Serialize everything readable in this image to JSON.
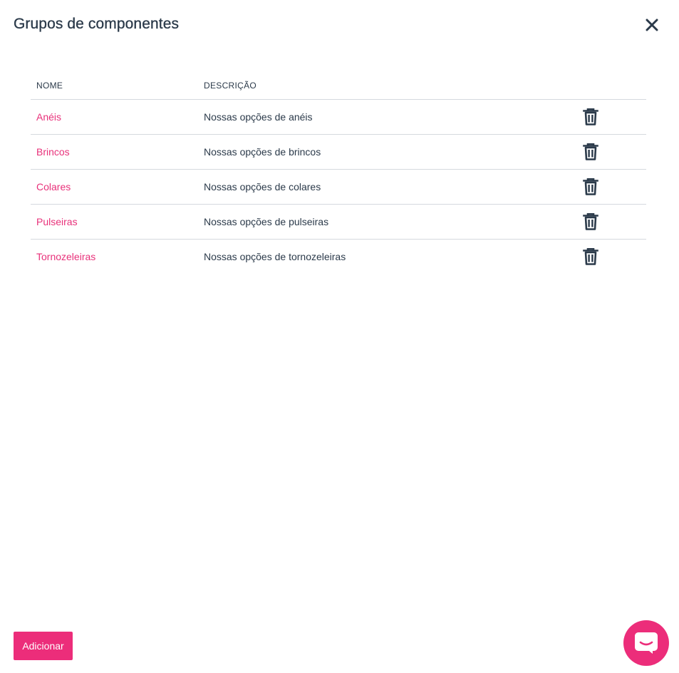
{
  "modal": {
    "title": "Grupos de componentes"
  },
  "table": {
    "headers": {
      "name": "NOME",
      "description": "DESCRIÇÃO"
    },
    "rows": [
      {
        "name": "Anéis",
        "description": "Nossas opções de anéis"
      },
      {
        "name": "Brincos",
        "description": "Nossas opções de brincos"
      },
      {
        "name": "Colares",
        "description": "Nossas opções de colares"
      },
      {
        "name": "Pulseiras",
        "description": "Nossas opções de pulseiras"
      },
      {
        "name": "Tornozeleiras",
        "description": "Nossas opções de tornozeleiras"
      }
    ]
  },
  "footer": {
    "add_label": "Adicionar"
  },
  "icons": {
    "close": "close-icon",
    "delete": "trash-icon",
    "chat": "chat-icon"
  },
  "colors": {
    "accent": "#ec2d7a",
    "link": "#e8317a",
    "text": "#2b3a4a"
  }
}
